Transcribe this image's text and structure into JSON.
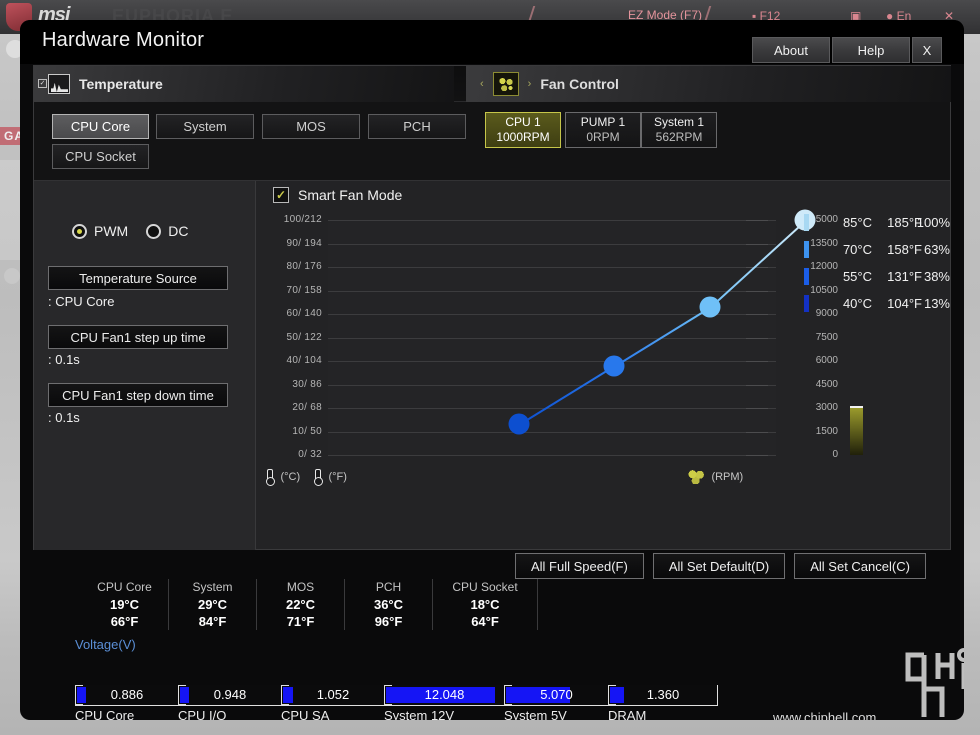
{
  "background": {
    "brand": "msi",
    "model": "EUPHORIA E",
    "ez_mode": "EZ Mode (F7)",
    "game_badge": "GA",
    "top_icons": [
      "■ F12",
      "▣",
      "● En",
      "✕"
    ]
  },
  "window": {
    "title": "Hardware Monitor",
    "buttons": [
      {
        "name": "about-button",
        "label": "About"
      },
      {
        "name": "help-button",
        "label": "Help"
      },
      {
        "name": "close-button",
        "label": "X"
      }
    ]
  },
  "sections": {
    "temperature": {
      "label": "Temperature",
      "icon": "temperature-graph-icon",
      "checkbox": "✓"
    },
    "fan_control": {
      "label": "Fan Control",
      "icon": "fan-icon",
      "prev": "‹",
      "next": "›"
    }
  },
  "temp_source_tabs": [
    {
      "label": "CPU Core",
      "active": true
    },
    {
      "label": "System",
      "active": false
    },
    {
      "label": "MOS",
      "active": false
    },
    {
      "label": "PCH",
      "active": false
    },
    {
      "label": "CPU Socket",
      "active": false
    }
  ],
  "fan_tabs": [
    {
      "name": "CPU 1",
      "rpm": "1000RPM",
      "active": true
    },
    {
      "name": "PUMP 1",
      "rpm": "0RPM",
      "active": false
    },
    {
      "name": "System 1",
      "rpm": "562RPM",
      "active": false
    }
  ],
  "mode": {
    "options": [
      {
        "label": "PWM",
        "selected": true
      },
      {
        "label": "DC",
        "selected": false
      }
    ]
  },
  "settings": [
    {
      "button": "Temperature Source",
      "value": ": CPU Core"
    },
    {
      "button": "CPU Fan1 step up time",
      "value": ": 0.1s"
    },
    {
      "button": "CPU Fan1 step down time",
      "value": ": 0.1s"
    }
  ],
  "smart_fan_mode": {
    "label": "Smart Fan Mode",
    "checked": true,
    "check_glyph": "✓"
  },
  "chart_data": {
    "type": "line",
    "title": "Smart Fan Mode",
    "xlabel": "",
    "ylabel": "Temperature (°C / °F)",
    "y2label": "RPM",
    "grid": true,
    "y_ticks": [
      "100/212",
      "90/ 194",
      "80/ 176",
      "70/ 158",
      "60/ 140",
      "50/ 122",
      "40/ 104",
      "30/  86",
      "20/  68",
      "10/  50",
      "0/  32"
    ],
    "y2_ticks": [
      "15000",
      "13500",
      "12000",
      "10500",
      "9000",
      "7500",
      "6000",
      "4500",
      "3000",
      "1500",
      "0"
    ],
    "ylim": [
      0,
      100
    ],
    "y2lim": [
      0,
      15000
    ],
    "legend_position": "right",
    "units": {
      "celsius": "(°C)",
      "fahrenheit": "(°F)",
      "rpm": "(RPM)"
    },
    "points": [
      {
        "temp_c": 40,
        "temp_f": 104,
        "duty": 13,
        "color": "#0d4fd0"
      },
      {
        "temp_c": 55,
        "temp_f": 131,
        "duty": 38,
        "color": "#2878ec"
      },
      {
        "temp_c": 70,
        "temp_f": 158,
        "duty": 63,
        "color": "#6fc0f7"
      },
      {
        "temp_c": 85,
        "temp_f": 185,
        "duty": 100,
        "color": "#cfeaf9"
      }
    ],
    "current_rpm_marker": 1000
  },
  "legend_rows": [
    {
      "c": "85°C",
      "f": "185°F",
      "pct": "100%",
      "color": "#a8d8f2"
    },
    {
      "c": "70°C",
      "f": "158°F",
      "pct": "63%",
      "color": "#3e93ef"
    },
    {
      "c": "55°C",
      "f": "131°F",
      "pct": "38%",
      "color": "#1b5ee8"
    },
    {
      "c": "40°C",
      "f": "104°F",
      "pct": "13%",
      "color": "#1331c4"
    }
  ],
  "actions": [
    {
      "label": "All Full Speed(F)"
    },
    {
      "label": "All Set Default(D)"
    },
    {
      "label": "All Set Cancel(C)"
    }
  ],
  "temp_readouts": [
    {
      "name": "CPU Core",
      "c": "19°C",
      "f": "66°F"
    },
    {
      "name": "System",
      "c": "29°C",
      "f": "84°F"
    },
    {
      "name": "MOS",
      "c": "22°C",
      "f": "71°F"
    },
    {
      "name": "PCH",
      "c": "36°C",
      "f": "96°F"
    },
    {
      "name": "CPU Socket",
      "c": "18°C",
      "f": "64°F"
    }
  ],
  "voltage": {
    "title": "Voltage(V)",
    "accent": "#1515f5",
    "items": [
      {
        "name": "CPU Core",
        "value": "0.886",
        "fill": 9
      },
      {
        "name": "CPU I/O",
        "value": "0.948",
        "fill": 9
      },
      {
        "name": "CPU SA",
        "value": "1.052",
        "fill": 10
      },
      {
        "name": "System 12V",
        "value": "12.048",
        "fill": 92
      },
      {
        "name": "System 5V",
        "value": "5.070",
        "fill": 63
      },
      {
        "name": "DRAM",
        "value": "1.360",
        "fill": 13
      }
    ]
  },
  "watermark": {
    "text": "www.chiphell.com"
  }
}
